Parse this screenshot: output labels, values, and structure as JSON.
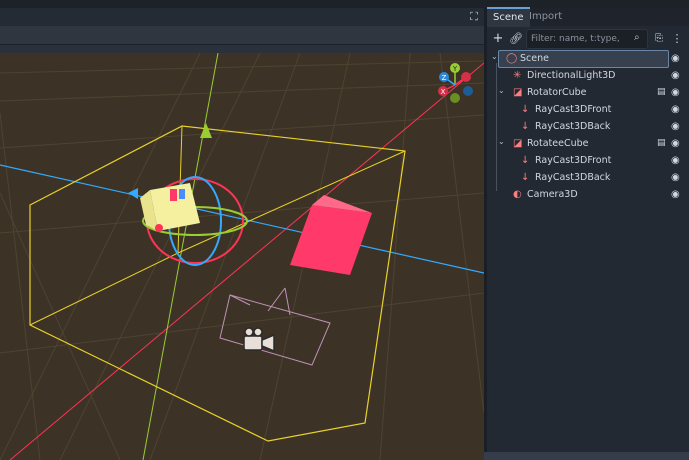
{
  "viewport": {
    "fullscreen_icon": "fullscreen-icon",
    "gizmo_axes": {
      "z": "Z",
      "y": "Y",
      "x": "X"
    }
  },
  "dock": {
    "tabs": [
      {
        "label": "Scene",
        "active": true
      },
      {
        "label": "Import",
        "active": false
      }
    ],
    "filter": {
      "placeholder": "Filter: name, t:type, g:grou",
      "value": ""
    },
    "icons": [
      "add-node-icon",
      "link-icon",
      "search-icon",
      "script-filter-icon",
      "more-icon"
    ]
  },
  "tree": [
    {
      "label": "Scene",
      "level": 0,
      "icon": "node3d-icon",
      "icon_color": "#fc7f7f",
      "expandable": true,
      "selected": true,
      "script": false
    },
    {
      "label": "DirectionalLight3D",
      "level": 1,
      "icon": "light-icon",
      "icon_color": "#fc7f7f",
      "expandable": false,
      "selected": false,
      "script": false
    },
    {
      "label": "RotatorCube",
      "level": 1,
      "icon": "mesh-icon",
      "icon_color": "#fc7f7f",
      "expandable": true,
      "selected": false,
      "script": true
    },
    {
      "label": "RayCast3DFront",
      "level": 2,
      "icon": "raycast-icon",
      "icon_color": "#fc7f7f",
      "expandable": false,
      "selected": false,
      "script": false
    },
    {
      "label": "RayCast3DBack",
      "level": 2,
      "icon": "raycast-icon",
      "icon_color": "#fc7f7f",
      "expandable": false,
      "selected": false,
      "script": false
    },
    {
      "label": "RotateeCube",
      "level": 1,
      "icon": "mesh-icon",
      "icon_color": "#fc7f7f",
      "expandable": true,
      "selected": false,
      "script": true
    },
    {
      "label": "RayCast3DFront",
      "level": 2,
      "icon": "raycast-icon",
      "icon_color": "#fc7f7f",
      "expandable": false,
      "selected": false,
      "script": false
    },
    {
      "label": "RayCast3DBack",
      "level": 2,
      "icon": "raycast-icon",
      "icon_color": "#fc7f7f",
      "expandable": false,
      "selected": false,
      "script": false
    },
    {
      "label": "Camera3D",
      "level": 1,
      "icon": "camera-icon",
      "icon_color": "#fc7f7f",
      "expandable": false,
      "selected": false,
      "script": false
    }
  ],
  "colors": {
    "viewport_bg": "#3c3326",
    "axis_x": "#ff3355",
    "axis_y": "#9acd32",
    "axis_z": "#33aaff",
    "bounds": "#e8d22a",
    "accent": "#6aa0d8"
  }
}
